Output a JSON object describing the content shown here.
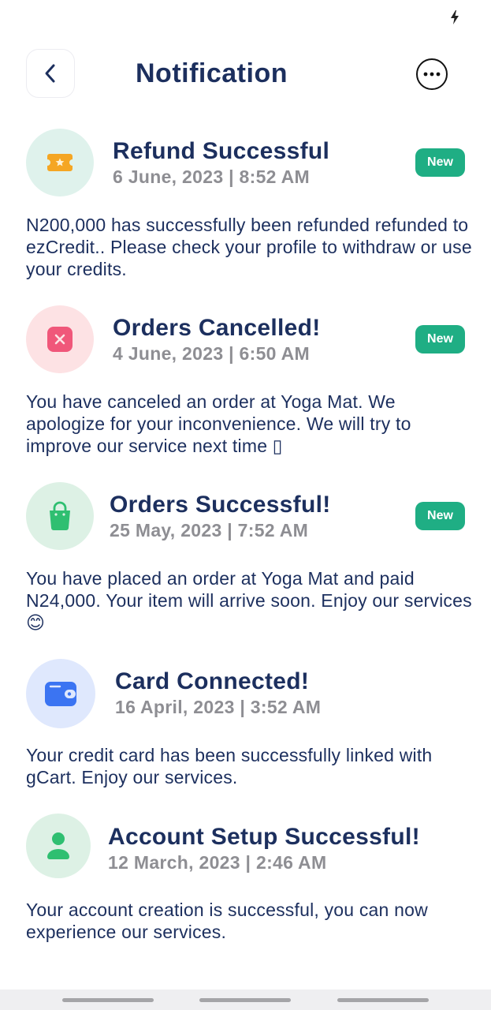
{
  "colors": {
    "title": "#1c2f5e",
    "date": "#8e8e93",
    "badge": "#1fae84",
    "refund_bg": "#dff2ec",
    "refund_icon": "#f5a623",
    "cancel_bg": "#fde2e4",
    "cancel_icon": "#f0577a",
    "success_bg": "#ddf1e5",
    "success_icon": "#2fbf71",
    "card_bg": "#dfe8fd",
    "card_icon": "#3b74f2",
    "account_bg": "#ddf1e5",
    "account_icon": "#2fbf71"
  },
  "header": {
    "title": "Notification",
    "back_icon": "chevron-left-icon",
    "more_icon": "more-horizontal-icon"
  },
  "notifications": [
    {
      "title": "Refund Successful",
      "date": "6 June, 2023 | 8:52 AM",
      "badge": "New",
      "icon": "ticket-icon",
      "body": "N200,000 has successfully been refunded refunded to  ezCredit.. Please check your profile to withdraw or use your credits."
    },
    {
      "title": "Orders Cancelled!",
      "date": "4 June, 2023 | 6:50 AM",
      "badge": "New",
      "icon": "close-square-icon",
      "body": "You have canceled an order at Yoga Mat. We apologize for your inconvenience. We will try to improve our service next time ▯"
    },
    {
      "title": "Orders Successful!",
      "date": "25 May, 2023 | 7:52 AM",
      "badge": "New",
      "icon": "shopping-bag-icon",
      "body": "You have placed an order at Yoga Mat and paid N24,000. Your item will arrive soon. Enjoy our services 😊"
    },
    {
      "title": "Card Connected!",
      "date": "16 April, 2023 | 3:52 AM",
      "icon": "wallet-icon",
      "body": "Your credit card has been successfully linked with gCart. Enjoy our services."
    },
    {
      "title": "Account Setup Successful!",
      "date": "12 March, 2023 | 2:46 AM",
      "icon": "user-icon",
      "body": "Your account creation is successful, you can now experience our services."
    }
  ]
}
